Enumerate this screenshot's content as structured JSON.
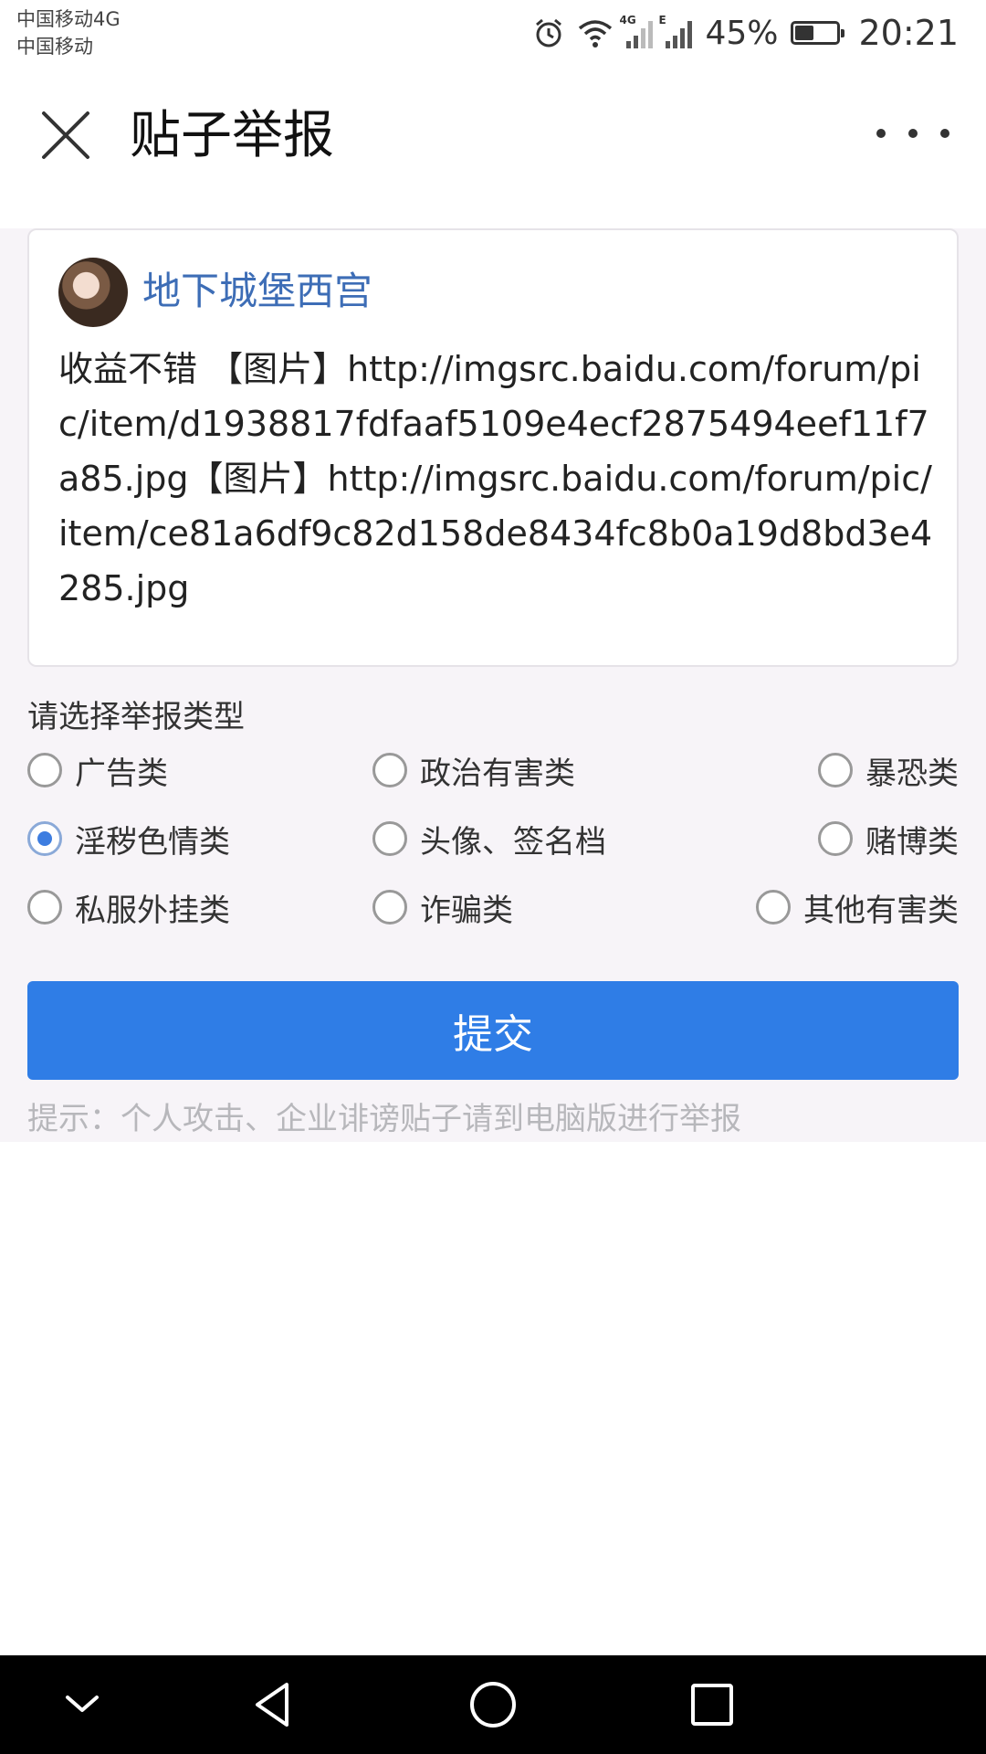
{
  "status_bar": {
    "carrier_line1": "中国移动4G",
    "carrier_line2": "中国移动",
    "net1_tag": "4G",
    "net2_tag": "E",
    "battery_percent_text": "45%",
    "battery_level": 0.45,
    "time": "20:21"
  },
  "header": {
    "title": "贴子举报",
    "close_icon": "close-icon",
    "more_icon": "more-icon"
  },
  "post": {
    "author": "地下城堡西宫",
    "content": "收益不错 【图片】http://imgsrc.baidu.com/forum/pic/item/d1938817fdfaaf5109e4ecf2875494eef11f7a85.jpg【图片】http://imgsrc.baidu.com/forum/pic/item/ce81a6df9c82d158de8434fc8b0a19d8bd3e4285.jpg"
  },
  "report": {
    "prompt": "请选择举报类型",
    "options": [
      {
        "label": "广告类",
        "checked": false
      },
      {
        "label": "政治有害类",
        "checked": false
      },
      {
        "label": "暴恐类",
        "checked": false
      },
      {
        "label": "淫秽色情类",
        "checked": true
      },
      {
        "label": "头像、签名档",
        "checked": false
      },
      {
        "label": "赌博类",
        "checked": false
      },
      {
        "label": "私服外挂类",
        "checked": false
      },
      {
        "label": "诈骗类",
        "checked": false
      },
      {
        "label": "其他有害类",
        "checked": false
      }
    ],
    "submit_label": "提交",
    "hint": "提示：个人攻击、企业诽谤贴子请到电脑版进行举报"
  },
  "colors": {
    "accent": "#2f7de6",
    "author": "#3d6db6",
    "hint": "#b7b7bb"
  }
}
